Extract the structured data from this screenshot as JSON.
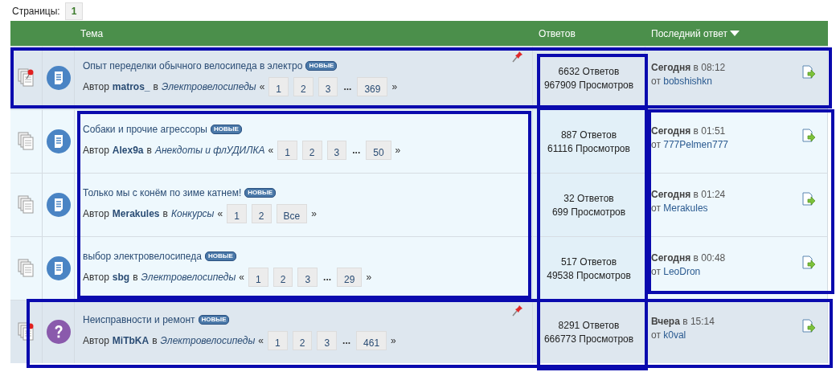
{
  "pager": {
    "label": "Страницы:",
    "pages": [
      {
        "label": "1",
        "selected": true
      }
    ]
  },
  "header": {
    "topic": "Тема",
    "replies": "Ответов",
    "last": "Последний ответ"
  },
  "topics": [
    {
      "pinned": true,
      "kind": "document",
      "title": "Опыт переделки обычного велосипеда в электро",
      "badge": "НОВЫЕ",
      "author_label": "Автор",
      "author": "matros_",
      "in_label": "в",
      "forum": "Электровелосипеды",
      "open": "«",
      "close": "»",
      "pages": [
        {
          "kind": "page",
          "label": "1"
        },
        {
          "kind": "page",
          "label": "2"
        },
        {
          "kind": "page",
          "label": "3"
        },
        {
          "kind": "gap",
          "label": "..."
        },
        {
          "kind": "page",
          "label": "369"
        }
      ],
      "replies": "6632 Ответов",
      "views": "967909 Просмотров",
      "last_when": "**Сегодня** в 08:12",
      "from_label": "от",
      "last_user": "bobshishkn"
    },
    {
      "pinned": false,
      "kind": "document",
      "title": "Собаки и прочие агрессоры",
      "badge": "НОВЫЕ",
      "author_label": "Автор",
      "author": "Alex9a",
      "in_label": "в",
      "forum": "Анекдоты и флУДИЛКА",
      "open": "«",
      "close": "»",
      "pages": [
        {
          "kind": "page",
          "label": "1"
        },
        {
          "kind": "page",
          "label": "2"
        },
        {
          "kind": "page",
          "label": "3"
        },
        {
          "kind": "gap",
          "label": "..."
        },
        {
          "kind": "page",
          "label": "50"
        }
      ],
      "replies": "887 Ответов",
      "views": "61116 Просмотров",
      "last_when": "**Сегодня** в 01:51",
      "from_label": "от",
      "last_user": "777Pelmen777"
    },
    {
      "pinned": false,
      "kind": "document",
      "title": "Только мы с конём по зиме катнем!",
      "badge": "НОВЫЕ",
      "author_label": "Автор",
      "author": "Merakules",
      "in_label": "в",
      "forum": "Конкурсы",
      "open": "«",
      "close": "»",
      "pages": [
        {
          "kind": "page",
          "label": "1"
        },
        {
          "kind": "page",
          "label": "2"
        },
        {
          "kind": "page",
          "label": "Все"
        }
      ],
      "replies": "32 Ответов",
      "views": "699 Просмотров",
      "last_when": "**Сегодня** в 01:24",
      "from_label": "от",
      "last_user": "Merakules"
    },
    {
      "pinned": false,
      "kind": "document",
      "title": "выбор электровелосипеда",
      "badge": "НОВЫЕ",
      "author_label": "Автор",
      "author": "sbg",
      "in_label": "в",
      "forum": "Электровелосипеды",
      "open": "«",
      "close": "»",
      "pages": [
        {
          "kind": "page",
          "label": "1"
        },
        {
          "kind": "page",
          "label": "2"
        },
        {
          "kind": "page",
          "label": "3"
        },
        {
          "kind": "gap",
          "label": "..."
        },
        {
          "kind": "page",
          "label": "29"
        }
      ],
      "replies": "517 Ответов",
      "views": "49538 Просмотров",
      "last_when": "**Сегодня** в 00:48",
      "from_label": "от",
      "last_user": "LeoDron"
    },
    {
      "pinned": true,
      "kind": "question",
      "title": "Неисправности и ремонт",
      "badge": "НОВЫЕ",
      "author_label": "Автор",
      "author": "MiTbKA",
      "in_label": "в",
      "forum": "Электровелосипеды",
      "open": "«",
      "close": "»",
      "pages": [
        {
          "kind": "page",
          "label": "1"
        },
        {
          "kind": "page",
          "label": "2"
        },
        {
          "kind": "page",
          "label": "3"
        },
        {
          "kind": "gap",
          "label": "..."
        },
        {
          "kind": "page",
          "label": "461"
        }
      ],
      "replies": "8291 Ответов",
      "views": "666773 Просмотров",
      "last_when": "**Вчера** в 15:14",
      "from_label": "от",
      "last_user": "k0val"
    }
  ]
}
